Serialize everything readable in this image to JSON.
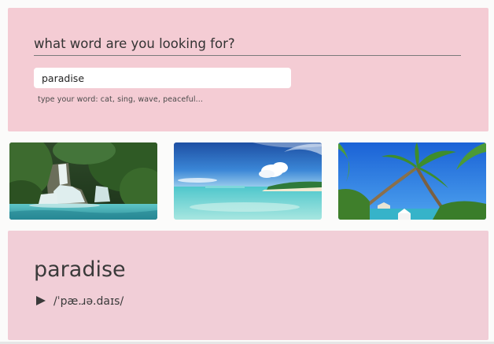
{
  "search": {
    "heading": "what word are you looking for?",
    "value": "paradise",
    "hint": "type your word: cat, sing, wave, peaceful..."
  },
  "gallery": {
    "images": [
      {
        "subject": "waterfall in tropical jungle"
      },
      {
        "subject": "turquoise beach lagoon with clouds"
      },
      {
        "subject": "palm trees over tropical sea"
      }
    ]
  },
  "result": {
    "word": "paradise",
    "play_icon": "play-icon",
    "phonetic": "/ˈpæ.ɹə.daɪs/"
  },
  "colors": {
    "search_panel": "#f4ccd4",
    "result_panel": "#f1ced7",
    "background": "#fbfbfa"
  }
}
